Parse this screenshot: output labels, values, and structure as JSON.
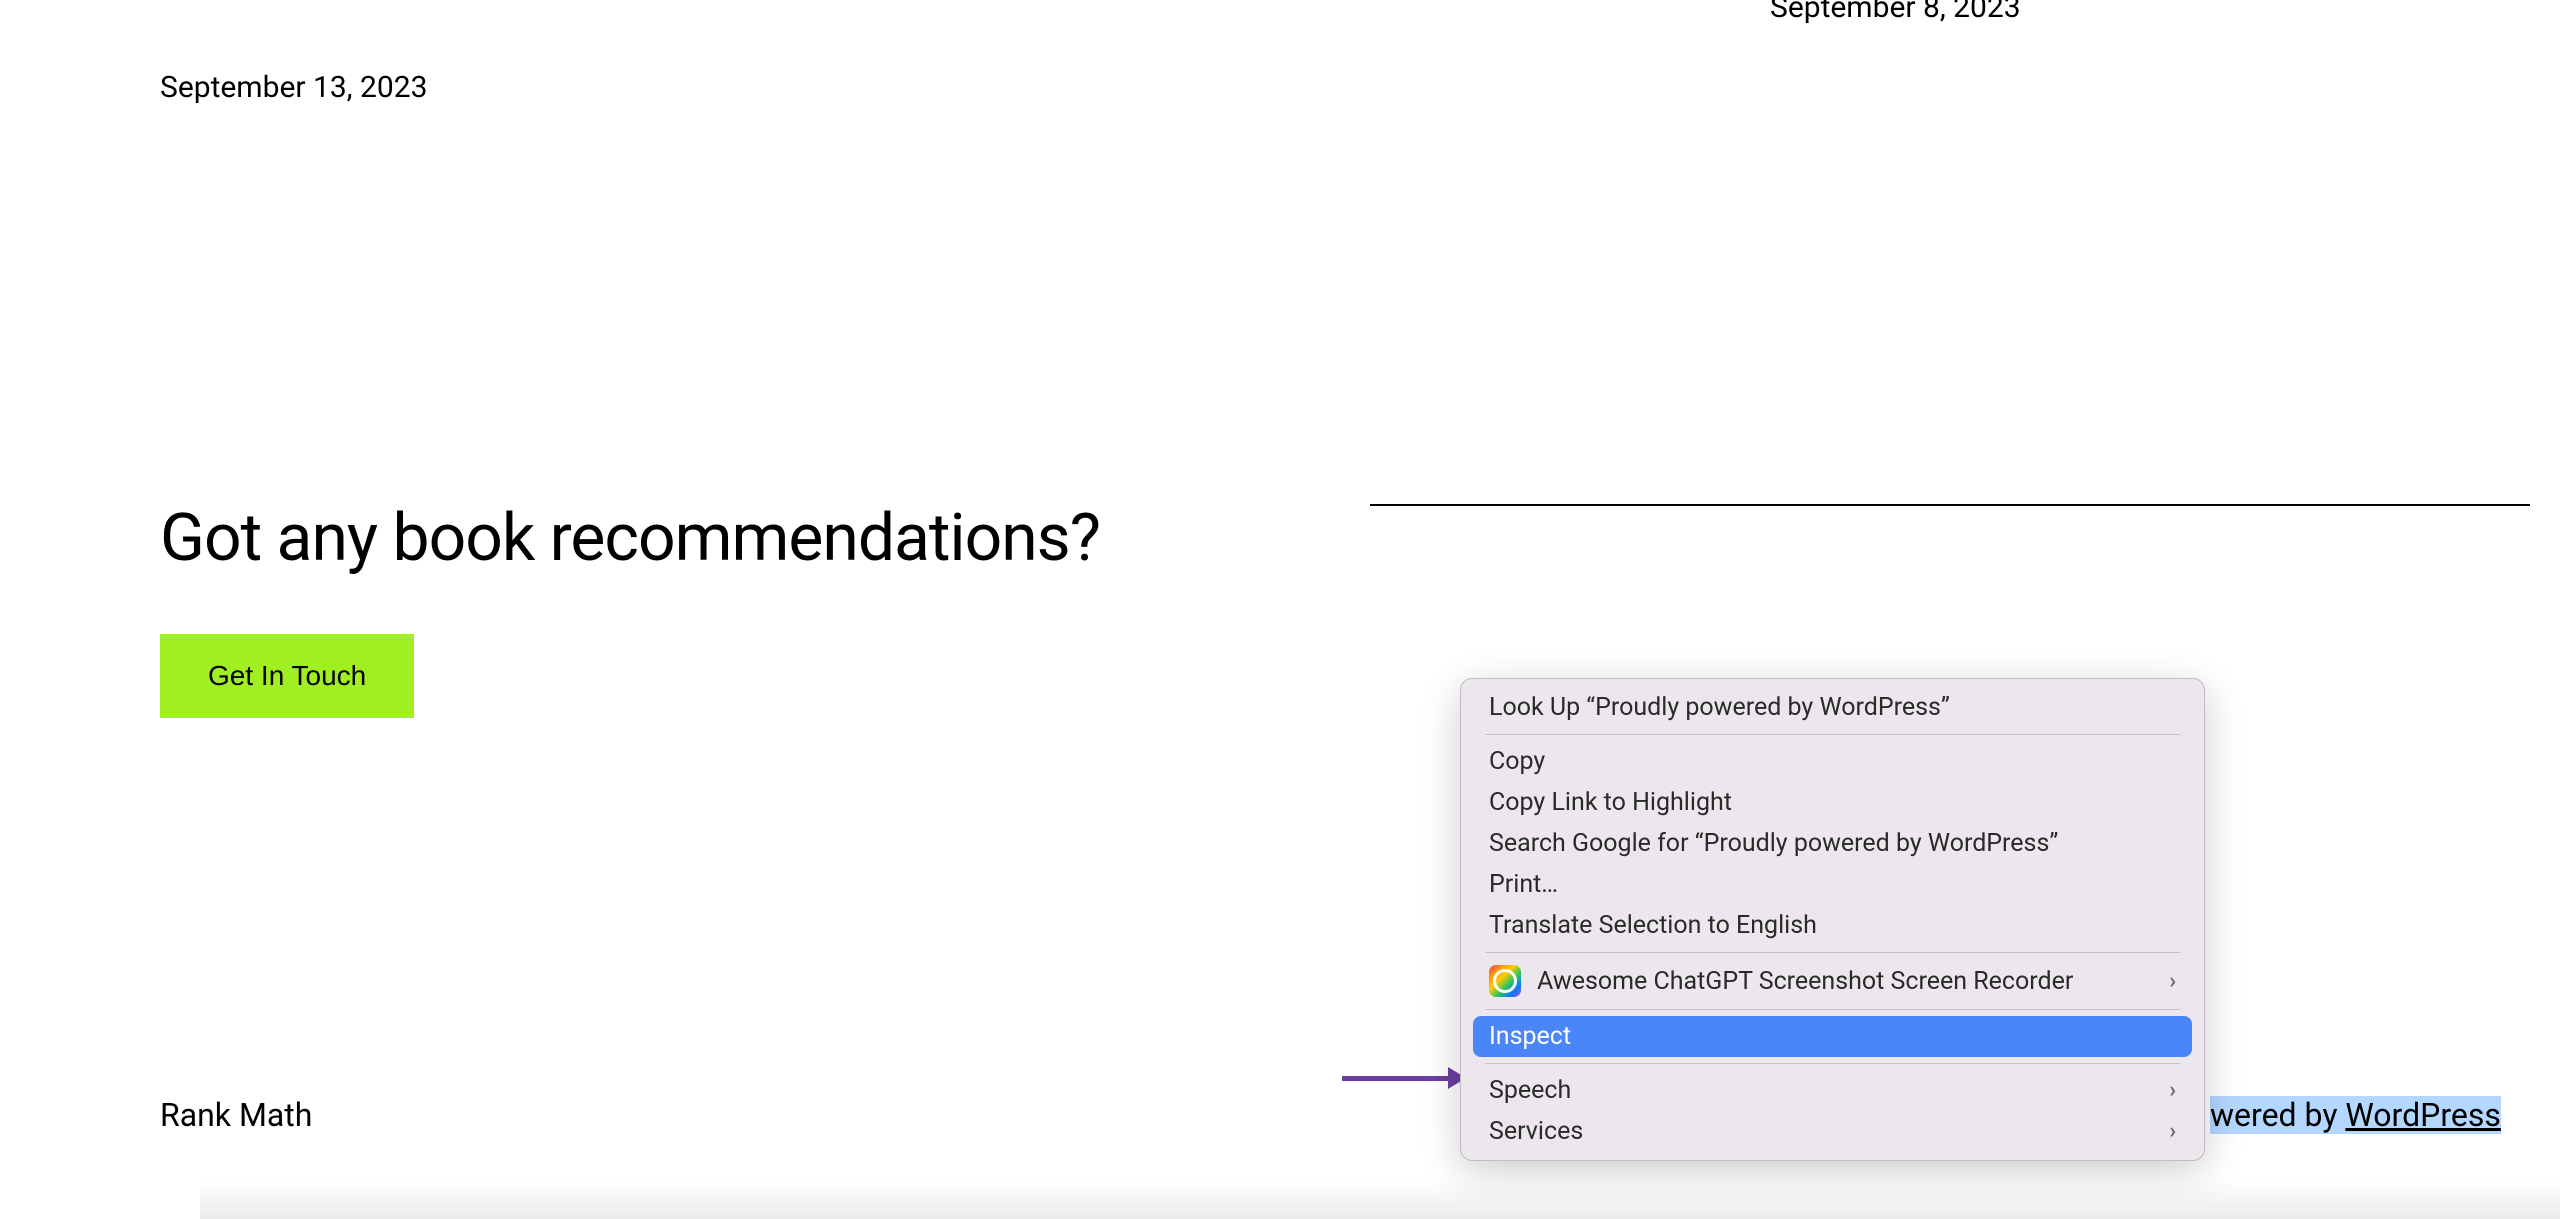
{
  "page": {
    "date_top_right": "September 8, 2023",
    "date_top_left": "September 13, 2023",
    "heading": "Got any book recommendations?",
    "cta_button": "Get In Touch",
    "footer_left": "Rank Math",
    "footer_right_prefix": "wered by ",
    "footer_right_link": "WordPress"
  },
  "context_menu": {
    "lookup": "Look Up “Proudly powered by WordPress”",
    "copy": "Copy",
    "copy_link": "Copy Link to Highlight",
    "search_google": "Search Google for “Proudly powered by WordPress”",
    "print": "Print…",
    "translate": "Translate Selection to English",
    "screenshot": "Awesome ChatGPT Screenshot  Screen Recorder",
    "inspect": "Inspect",
    "speech": "Speech",
    "services": "Services"
  }
}
